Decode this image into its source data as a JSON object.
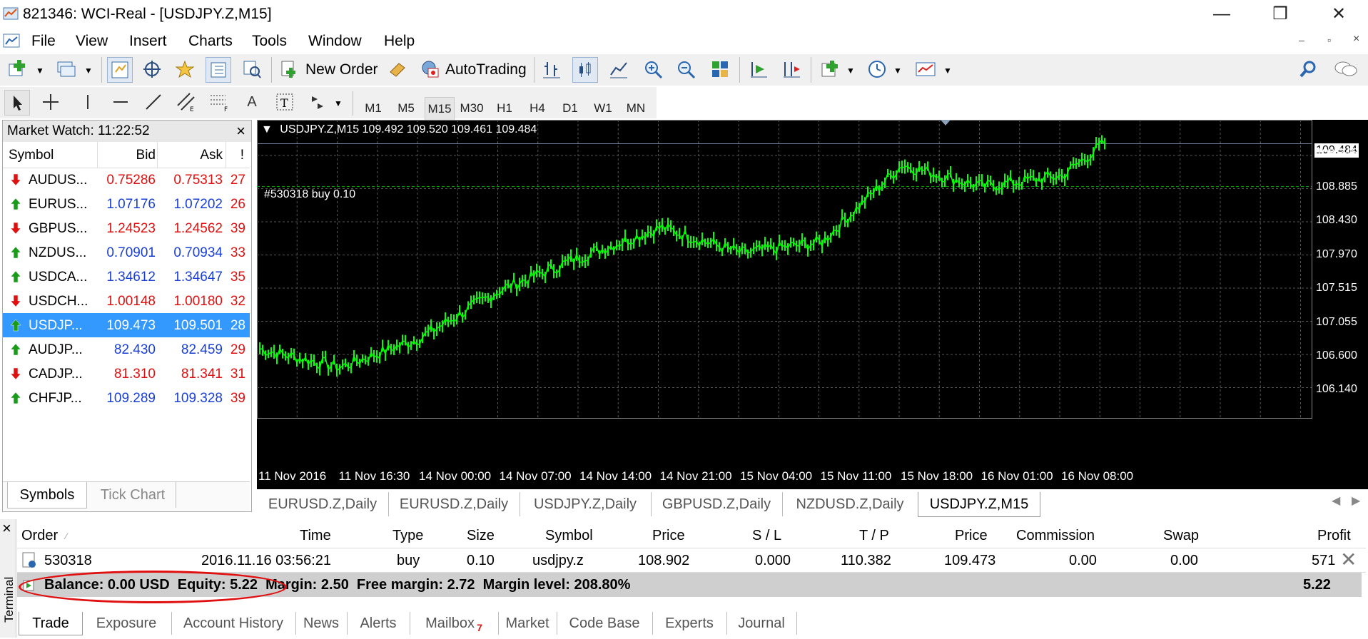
{
  "window": {
    "title": "821346: WCI-Real - [USDJPY.Z,M15]",
    "minimize": "—",
    "restore": "❒",
    "close": "✕"
  },
  "menu": [
    "File",
    "View",
    "Insert",
    "Charts",
    "Tools",
    "Window",
    "Help"
  ],
  "toolbar": {
    "new_order": "New Order",
    "autotrading": "AutoTrading"
  },
  "timeframes": [
    "M1",
    "M5",
    "M15",
    "M30",
    "H1",
    "H4",
    "D1",
    "W1",
    "MN"
  ],
  "active_timeframe": "M15",
  "market_watch": {
    "title": "Market Watch: 11:22:52",
    "close": "×",
    "columns": {
      "symbol": "Symbol",
      "bid": "Bid",
      "ask": "Ask",
      "spread": "!"
    },
    "rows": [
      {
        "symbol": "AUDUS...",
        "bid": "0.75286",
        "ask": "0.75313",
        "spread": "27",
        "dir": "down"
      },
      {
        "symbol": "EURUS...",
        "bid": "1.07176",
        "ask": "1.07202",
        "spread": "26",
        "dir": "up"
      },
      {
        "symbol": "GBPUS...",
        "bid": "1.24523",
        "ask": "1.24562",
        "spread": "39",
        "dir": "down"
      },
      {
        "symbol": "NZDUS...",
        "bid": "0.70901",
        "ask": "0.70934",
        "spread": "33",
        "dir": "up"
      },
      {
        "symbol": "USDCA...",
        "bid": "1.34612",
        "ask": "1.34647",
        "spread": "35",
        "dir": "up"
      },
      {
        "symbol": "USDCH...",
        "bid": "1.00148",
        "ask": "1.00180",
        "spread": "32",
        "dir": "down"
      },
      {
        "symbol": "USDJP...",
        "bid": "109.473",
        "ask": "109.501",
        "spread": "28",
        "dir": "up",
        "selected": true
      },
      {
        "symbol": "AUDJP...",
        "bid": "82.430",
        "ask": "82.459",
        "spread": "29",
        "dir": "up"
      },
      {
        "symbol": "CADJP...",
        "bid": "81.310",
        "ask": "81.341",
        "spread": "31",
        "dir": "down"
      },
      {
        "symbol": "CHFJP...",
        "bid": "109.289",
        "ask": "109.328",
        "spread": "39",
        "dir": "up"
      }
    ],
    "tabs": [
      "Symbols",
      "Tick Chart"
    ]
  },
  "chart": {
    "header": "USDJPY.Z,M15  109.492 109.520 109.461 109.484",
    "order_line_label": "#530318 buy 0.10",
    "current_price": "109.484",
    "order_price": 108.902,
    "ymin": 105.9,
    "ymax": 109.75,
    "y_ticks": [
      "109.345",
      "108.885",
      "108.430",
      "107.970",
      "107.515",
      "107.055",
      "106.600",
      "106.140"
    ],
    "x_ticks": [
      "11 Nov 2016",
      "11 Nov 16:30",
      "14 Nov 00:00",
      "14 Nov 07:00",
      "14 Nov 14:00",
      "14 Nov 21:00",
      "15 Nov 04:00",
      "15 Nov 11:00",
      "15 Nov 18:00",
      "16 Nov 01:00",
      "16 Nov 08:00"
    ]
  },
  "chart_data": {
    "type": "line",
    "title": "USDJPY.Z,M15",
    "x": [
      "11 Nov 2016",
      "11 Nov 16:30",
      "14 Nov 00:00",
      "14 Nov 07:00",
      "14 Nov 14:00",
      "14 Nov 21:00",
      "15 Nov 04:00",
      "15 Nov 11:00",
      "15 Nov 18:00",
      "16 Nov 01:00",
      "16 Nov 08:00"
    ],
    "series": [
      {
        "values": [
          106.7,
          106.45,
          106.85,
          107.5,
          107.95,
          108.35,
          108.0,
          108.15,
          109.2,
          108.9,
          109.05
        ]
      }
    ],
    "ylim": [
      105.9,
      109.75
    ],
    "grid": true
  },
  "chart_tabs": [
    "EURUSD.Z,Daily",
    "EURUSD.Z,Daily",
    "USDJPY.Z,Daily",
    "GBPUSD.Z,Daily",
    "NZDUSD.Z,Daily",
    "USDJPY.Z,M15"
  ],
  "active_chart_tab": 5,
  "terminal": {
    "side_label": "Terminal",
    "close": "×",
    "columns": {
      "order": "Order",
      "time": "Time",
      "type": "Type",
      "size": "Size",
      "symbol": "Symbol",
      "price": "Price",
      "sl": "S / L",
      "tp": "T / P",
      "price2": "Price",
      "commission": "Commission",
      "swap": "Swap",
      "profit": "Profit"
    },
    "order_row": {
      "order": "530318",
      "time": "2016.11.16 03:56:21",
      "type": "buy",
      "size": "0.10",
      "symbol": "usdjpy.z",
      "price": "108.902",
      "sl": "0.000",
      "tp": "110.382",
      "price2": "109.473",
      "commission": "0.00",
      "swap": "0.00",
      "profit": "571"
    },
    "summary": "Balance: 0.00 USD  Equity: 5.22  Margin: 2.50  Free margin: 2.72  Margin level: 208.80%",
    "summary_profit": "5.22",
    "tabs": [
      "Trade",
      "Exposure",
      "Account History",
      "News",
      "Alerts",
      "Mailbox",
      "Market",
      "Code Base",
      "Experts",
      "Journal"
    ],
    "mailbox_badge": "7"
  },
  "colors": {
    "accent_select": "#3399ff",
    "down": "#e01010",
    "up": "#1a9b1a",
    "candle": "#00ff00",
    "annotation": "#e01010"
  }
}
